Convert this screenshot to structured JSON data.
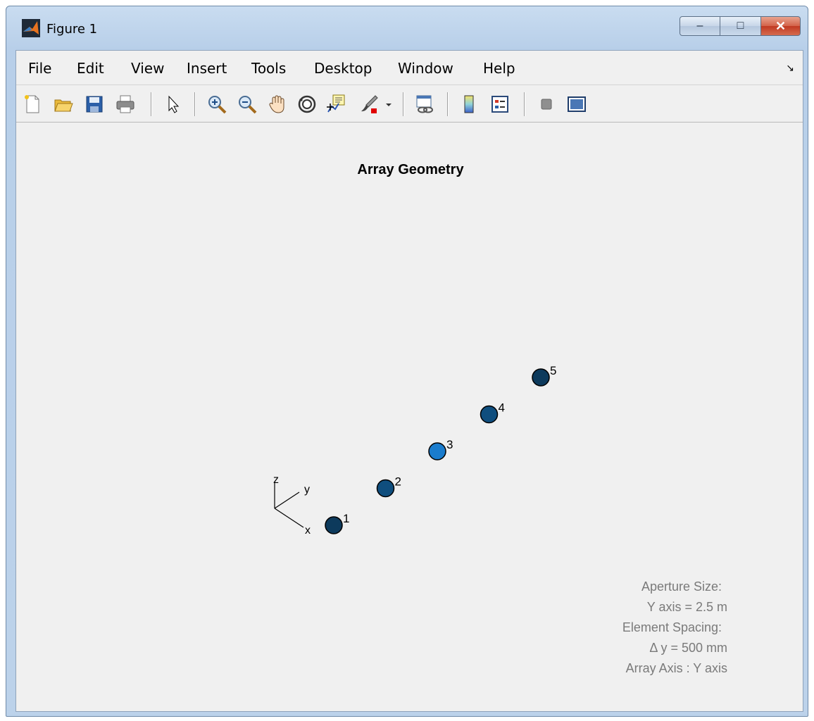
{
  "window": {
    "title": "Figure 1",
    "buttons": {
      "minimize": "–",
      "maximize": "□",
      "close": "✕"
    }
  },
  "menubar": {
    "items": [
      "File",
      "Edit",
      "View",
      "Insert",
      "Tools",
      "Desktop",
      "Window",
      "Help"
    ],
    "dock_arrow": "↘"
  },
  "toolbar": {
    "icons": [
      "new-figure-icon",
      "open-file-icon",
      "save-icon",
      "print-icon",
      "edit-plot-arrow-icon",
      "zoom-in-icon",
      "zoom-out-icon",
      "pan-hand-icon",
      "rotate-3d-icon",
      "data-cursor-icon",
      "brush-icon",
      "link-plot-icon",
      "colorbar-icon",
      "legend-icon",
      "hide-plot-tools-icon",
      "show-plot-tools-icon"
    ]
  },
  "plot": {
    "title": "Array Geometry",
    "axes_labels": {
      "z": "z",
      "y": "y",
      "x": "x"
    },
    "info_lines": [
      "Aperture Size:",
      "Y axis = 2.5 m",
      "Element Spacing:",
      "Δ y = 500 mm",
      "Array Axis : Y axis"
    ]
  },
  "chart_data": {
    "type": "scatter",
    "title": "Array Geometry",
    "points": [
      {
        "label": "1",
        "y": -1.0,
        "color": "#0d3a5c"
      },
      {
        "label": "2",
        "y": -0.5,
        "color": "#0f4e7e"
      },
      {
        "label": "3",
        "y": 0.0,
        "color": "#1a7ccd"
      },
      {
        "label": "4",
        "y": 0.5,
        "color": "#0f4e7e"
      },
      {
        "label": "5",
        "y": 1.0,
        "color": "#0d3a5c"
      }
    ],
    "grid": false
  }
}
